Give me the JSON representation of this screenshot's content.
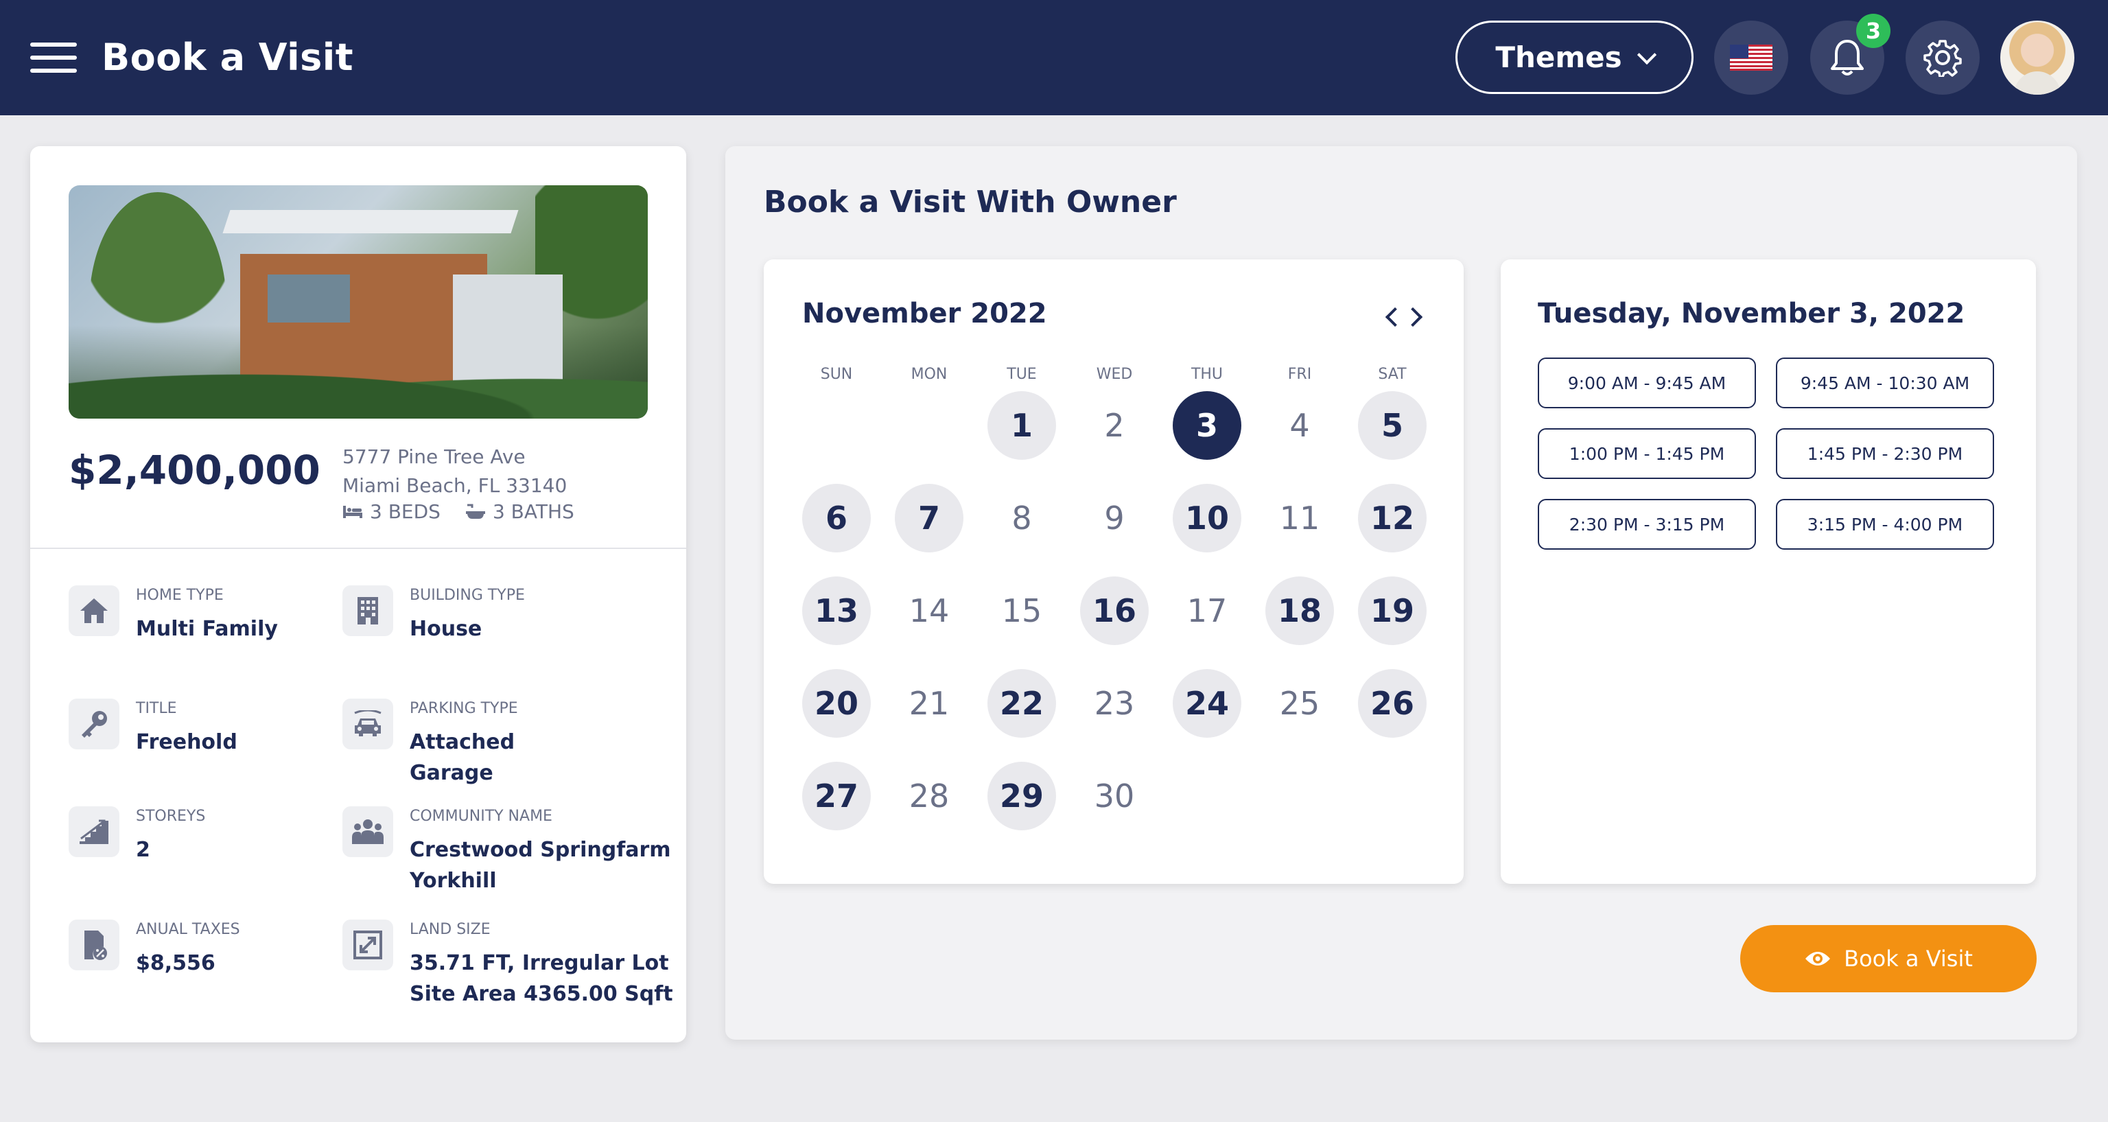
{
  "header": {
    "title": "Book a Visit",
    "themes_label": "Themes",
    "notification_count": "3"
  },
  "property": {
    "price": "$2,400,000",
    "address_line1": "5777 Pine Tree Ave",
    "address_line2": "Miami Beach, FL 33140",
    "beds": "3 BEDS",
    "baths": "3 BATHS",
    "details": [
      {
        "label": "HOME TYPE",
        "value": "Multi Family",
        "icon": "home-icon"
      },
      {
        "label": "BUILDING TYPE",
        "value": "House",
        "icon": "building-icon"
      },
      {
        "label": "TITLE",
        "value": "Freehold",
        "icon": "key-icon"
      },
      {
        "label": "PARKING TYPE",
        "value": "Attached\nGarage",
        "icon": "car-icon"
      },
      {
        "label": "STOREYS",
        "value": "2",
        "icon": "stairs-icon"
      },
      {
        "label": "COMMUNITY NAME",
        "value": "Crestwood Springfarm\nYorkhill",
        "icon": "people-icon"
      },
      {
        "label": "ANUAL TAXES",
        "value": "$8,556",
        "icon": "tax-document-icon"
      },
      {
        "label": "LAND SIZE",
        "value": "35.71 FT, Irregular Lot\nSite Area 4365.00 Sqft",
        "icon": "resize-icon"
      }
    ]
  },
  "booking": {
    "title": "Book a Visit With Owner",
    "calendar": {
      "month": "November 2022",
      "weekdays": [
        "SUN",
        "MON",
        "TUE",
        "WED",
        "THU",
        "FRI",
        "SAT"
      ],
      "first_weekday_index": 2,
      "days_in_month": 30,
      "selected_day": 3,
      "available_days": [
        1,
        3,
        5,
        6,
        7,
        10,
        12,
        13,
        16,
        18,
        19,
        20,
        22,
        24,
        26,
        27,
        29
      ]
    },
    "slots": {
      "date_label": "Tuesday, November 3, 2022",
      "times": [
        "9:00 AM - 9:45 AM",
        "9:45 AM - 10:30 AM",
        "1:00 PM - 1:45 PM",
        "1:45 PM - 2:30 PM",
        "2:30 PM - 3:15 PM",
        "3:15 PM - 4:00 PM"
      ]
    },
    "book_button_label": "Book a Visit"
  },
  "colors": {
    "navy": "#1e2a55",
    "accent_orange": "#f39112",
    "badge_green": "#2ebd59"
  }
}
